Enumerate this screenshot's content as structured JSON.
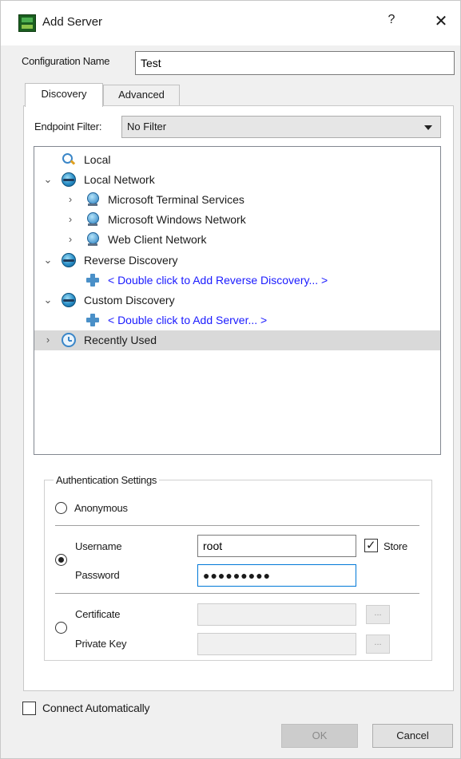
{
  "window": {
    "title": "Add Server",
    "help_label": "?",
    "close_label": "✕"
  },
  "config": {
    "label": "Configuration Name",
    "value": "Test"
  },
  "tabs": [
    {
      "label": "Discovery",
      "active": true
    },
    {
      "label": "Advanced",
      "active": false
    }
  ],
  "endpoint_filter": {
    "label": "Endpoint Filter:",
    "selected": "No Filter"
  },
  "tree": {
    "items": [
      {
        "label": "Local",
        "icon": "search-icon",
        "expander": "",
        "level": 0
      },
      {
        "label": "Local Network",
        "icon": "globe-icon",
        "expander": "⌄",
        "level": 0
      },
      {
        "label": "Microsoft Terminal Services",
        "icon": "network-icon",
        "expander": "›",
        "level": 1
      },
      {
        "label": "Microsoft Windows Network",
        "icon": "network-icon",
        "expander": "›",
        "level": 1
      },
      {
        "label": "Web Client Network",
        "icon": "network-icon",
        "expander": "›",
        "level": 1
      },
      {
        "label": "Reverse Discovery",
        "icon": "globe-icon",
        "expander": "⌄",
        "level": 0
      },
      {
        "label": "< Double click to Add Reverse Discovery... >",
        "icon": "plus-icon",
        "expander": "",
        "level": 1,
        "link": true
      },
      {
        "label": "Custom Discovery",
        "icon": "globe-icon",
        "expander": "⌄",
        "level": 0
      },
      {
        "label": "< Double click to Add Server... >",
        "icon": "plus-icon",
        "expander": "",
        "level": 1,
        "link": true
      },
      {
        "label": "Recently Used",
        "icon": "clock-icon",
        "expander": "›",
        "level": 0,
        "selected": true
      }
    ]
  },
  "auth": {
    "legend": "Authentication Settings",
    "anonymous_label": "Anonymous",
    "username_label": "Username",
    "username_value": "root",
    "store_label": "Store",
    "store_checked": true,
    "password_label": "Password",
    "password_mask": "●●●●●●●●●",
    "certificate_label": "Certificate",
    "private_key_label": "Private Key",
    "browse_label": "...",
    "selected_method": "username"
  },
  "connect_auto": {
    "label": "Connect Automatically",
    "checked": false
  },
  "buttons": {
    "ok": "OK",
    "cancel": "Cancel"
  }
}
